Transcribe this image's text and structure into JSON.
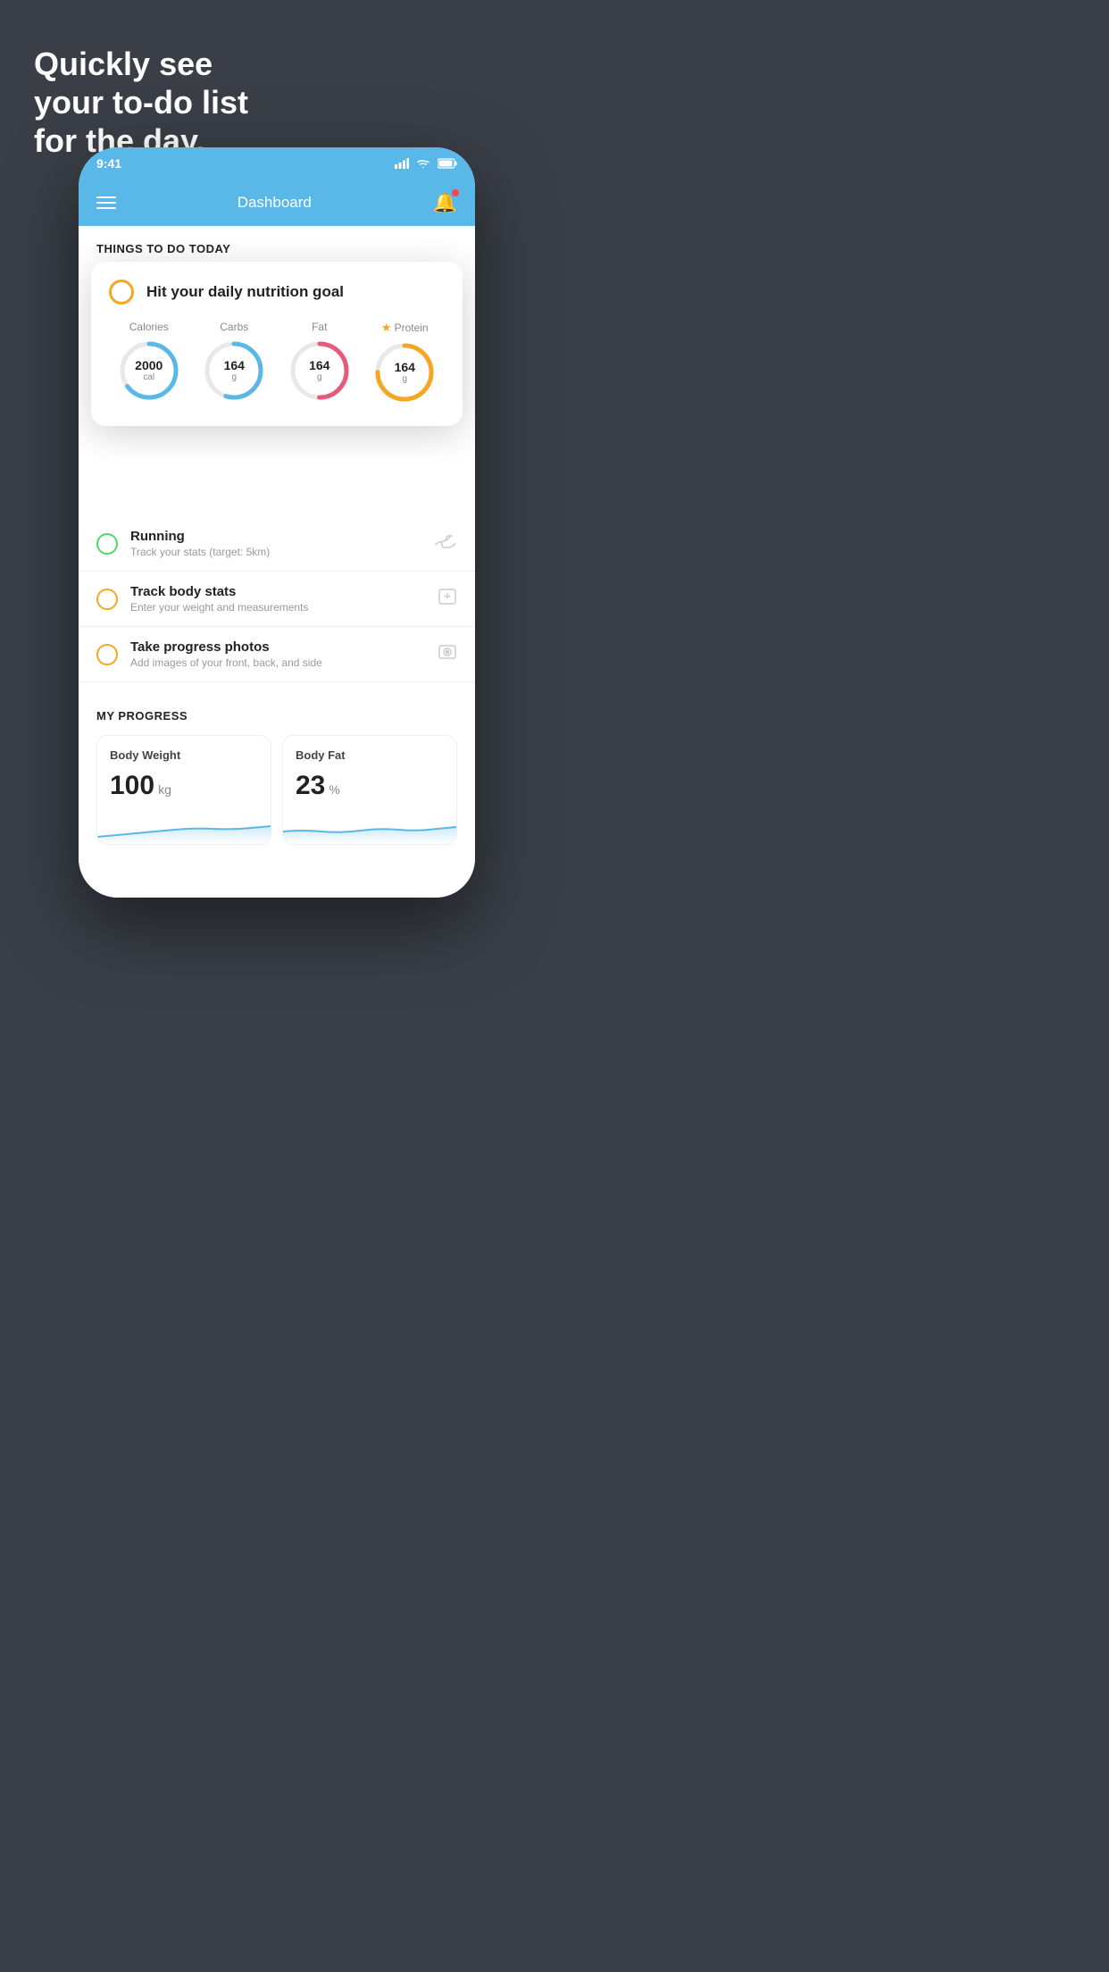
{
  "hero": {
    "line1": "Quickly see",
    "line2": "your to-do list",
    "line3": "for the day."
  },
  "status_bar": {
    "time": "9:41",
    "icons": "▲▲▲ ◉ ▐▌"
  },
  "nav": {
    "title": "Dashboard"
  },
  "section1": {
    "header": "THINGS TO DO TODAY"
  },
  "floating_card": {
    "title": "Hit your daily nutrition goal",
    "nutrition": [
      {
        "label": "Calories",
        "value": "2000",
        "unit": "cal",
        "color": "#5ab8e8",
        "percent": 65,
        "star": false
      },
      {
        "label": "Carbs",
        "value": "164",
        "unit": "g",
        "color": "#5ab8e8",
        "percent": 55,
        "star": false
      },
      {
        "label": "Fat",
        "value": "164",
        "unit": "g",
        "color": "#e85a7a",
        "percent": 50,
        "star": false
      },
      {
        "label": "Protein",
        "value": "164",
        "unit": "g",
        "color": "#f5a623",
        "percent": 75,
        "star": true
      }
    ]
  },
  "todo_items": [
    {
      "title": "Running",
      "subtitle": "Track your stats (target: 5km)",
      "circle_color": "green",
      "icon": "shoe"
    },
    {
      "title": "Track body stats",
      "subtitle": "Enter your weight and measurements",
      "circle_color": "yellow",
      "icon": "scale"
    },
    {
      "title": "Take progress photos",
      "subtitle": "Add images of your front, back, and side",
      "circle_color": "yellow",
      "icon": "photo"
    }
  ],
  "progress": {
    "header": "MY PROGRESS",
    "cards": [
      {
        "title": "Body Weight",
        "value": "100",
        "unit": "kg"
      },
      {
        "title": "Body Fat",
        "value": "23",
        "unit": "%"
      }
    ]
  }
}
